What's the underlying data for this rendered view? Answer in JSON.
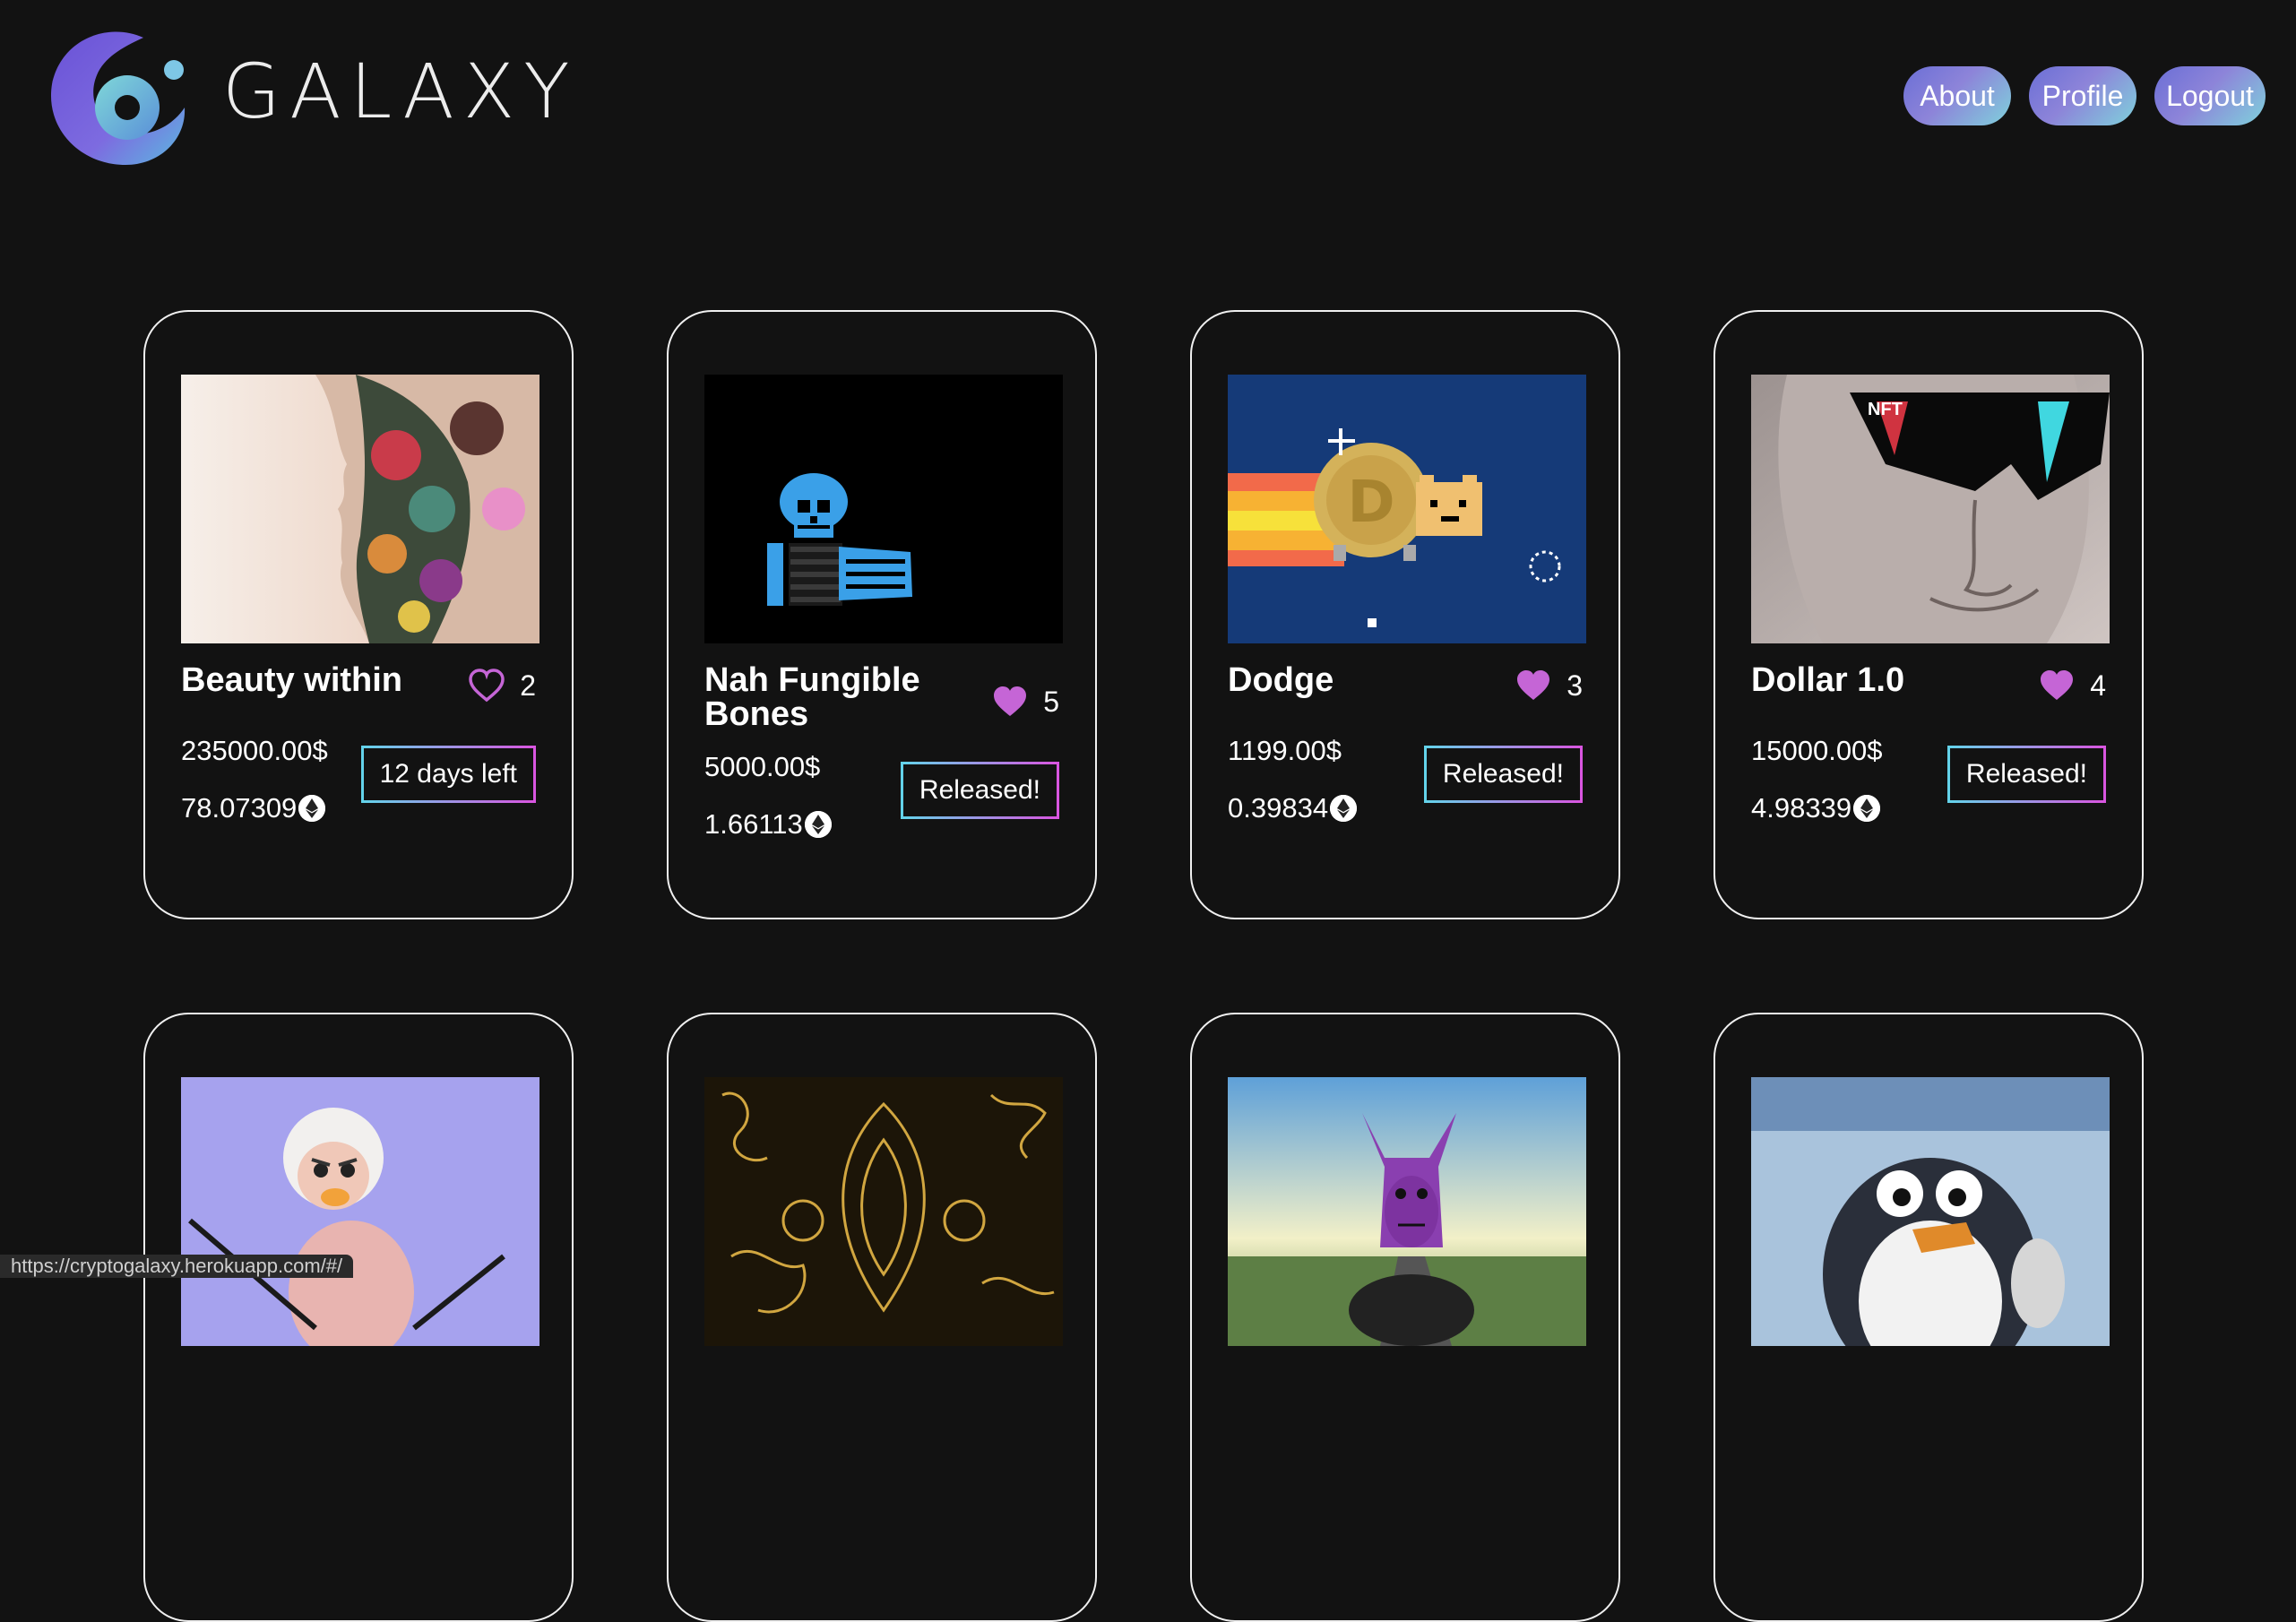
{
  "brand": {
    "name": "GALAXY"
  },
  "nav": [
    {
      "label": "About"
    },
    {
      "label": "Profile"
    },
    {
      "label": "Logout"
    }
  ],
  "cards": [
    {
      "title": "Beauty within",
      "likes": "2",
      "liked": false,
      "usd": "235000.00$",
      "eth": "78.07309",
      "status": "12 days left"
    },
    {
      "title": "Nah Fungible Bones",
      "likes": "5",
      "liked": true,
      "usd": "5000.00$",
      "eth": "1.66113",
      "status": "Released!"
    },
    {
      "title": "Dodge",
      "likes": "3",
      "liked": true,
      "usd": "1199.00$",
      "eth": "0.39834",
      "status": "Released!"
    },
    {
      "title": "Dollar 1.0",
      "likes": "4",
      "liked": true,
      "usd": "15000.00$",
      "eth": "4.98339",
      "status": "Released!"
    }
  ],
  "browser": {
    "status_url": "https://cryptogalaxy.herokuapp.com/#/"
  },
  "colors": {
    "heart": "#c565d6",
    "accent_start": "#63d3ea",
    "accent_end": "#d955e0"
  }
}
